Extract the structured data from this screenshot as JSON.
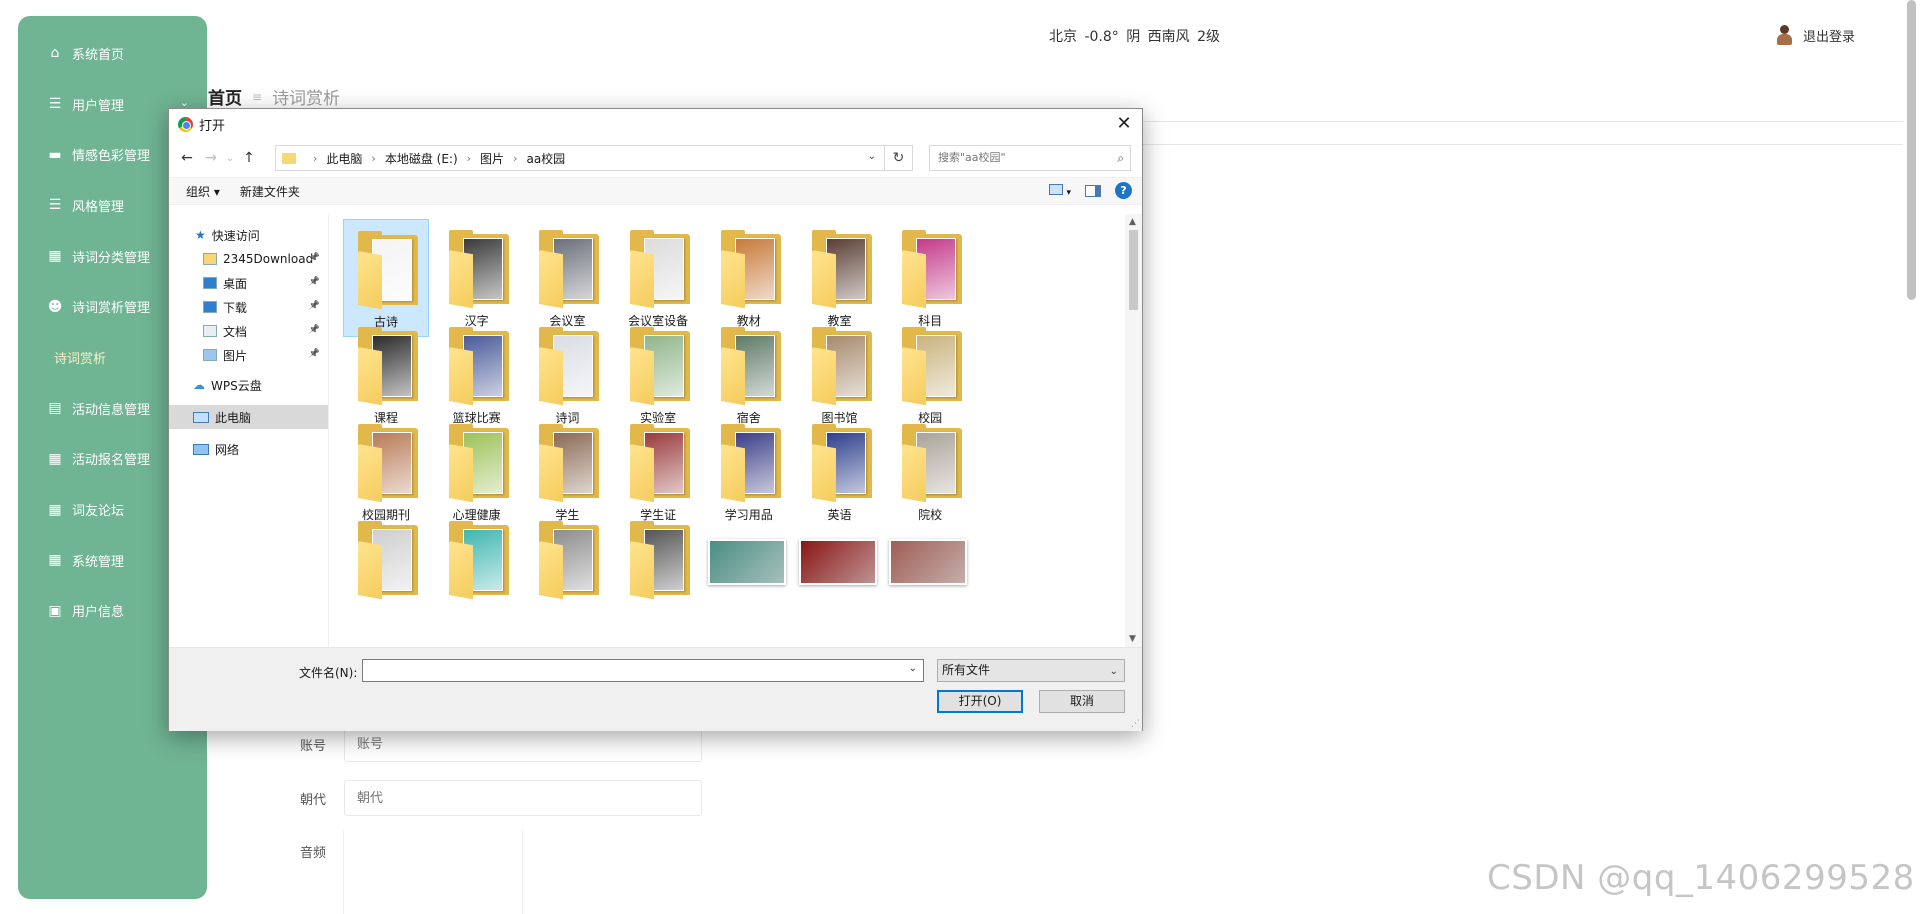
{
  "sidebar": {
    "items": [
      {
        "label": "系统首页",
        "icon": "home-icon",
        "glyph": "⌂"
      },
      {
        "label": "用户管理",
        "icon": "list-icon",
        "glyph": "☰",
        "chevron": "⌄"
      },
      {
        "label": "情感色彩管理",
        "icon": "monitor-icon",
        "glyph": "▬"
      },
      {
        "label": "风格管理",
        "icon": "list-icon",
        "glyph": "☰"
      },
      {
        "label": "诗词分类管理",
        "icon": "grid-icon",
        "glyph": "▦"
      },
      {
        "label": "诗词赏析管理",
        "icon": "user-icon",
        "glyph": "☻"
      },
      {
        "label": "诗词赏析",
        "icon": "",
        "glyph": "",
        "sub": true
      },
      {
        "label": "活动信息管理",
        "icon": "clipboard-icon",
        "glyph": "▤"
      },
      {
        "label": "活动报名管理",
        "icon": "grid-icon",
        "glyph": "▦"
      },
      {
        "label": "词友论坛",
        "icon": "grid-icon",
        "glyph": "▦"
      },
      {
        "label": "系统管理",
        "icon": "grid-icon",
        "glyph": "▦"
      },
      {
        "label": "用户信息",
        "icon": "card-icon",
        "glyph": "▣"
      }
    ]
  },
  "header": {
    "weather": "北京  -0.8°  阴  西南风  2级",
    "logout_label": "退出登录"
  },
  "breadcrumb": {
    "home": "首页",
    "separator": "≡",
    "current": "诗词赏析"
  },
  "form": {
    "account_label": "账号",
    "account_placeholder": "账号",
    "dynasty_label": "朝代",
    "dynasty_placeholder": "朝代",
    "audio_label": "音频"
  },
  "watermark": "CSDN @qq_1406299528",
  "dialog": {
    "title": "打开",
    "close": "✕",
    "nav": {
      "back": "←",
      "forward": "→",
      "recent": "⌄",
      "up": "↑",
      "refresh": "↻"
    },
    "address": [
      "此电脑",
      "本地磁盘 (E:)",
      "图片",
      "aa校园"
    ],
    "address_sep": "›",
    "search_placeholder": "搜索\"aa校园\"",
    "toolbar": {
      "organize": "组织 ▾",
      "new_folder": "新建文件夹",
      "help": "?"
    },
    "nav_pane": {
      "quick_access": "快速访问",
      "pinned": [
        {
          "label": "2345Download",
          "icon": "folder-icon"
        },
        {
          "label": "桌面",
          "icon": "desktop-icon"
        },
        {
          "label": "下载",
          "icon": "download-icon"
        },
        {
          "label": "文档",
          "icon": "document-icon"
        },
        {
          "label": "图片",
          "icon": "pictures-icon"
        }
      ],
      "wps": "WPS云盘",
      "this_pc": "此电脑",
      "network": "网络"
    },
    "items": [
      {
        "label": "古诗",
        "type": "folder",
        "selected": true,
        "thumb": "#f4f4f4"
      },
      {
        "label": "汉字",
        "type": "folder",
        "thumb": "#3a3a3a"
      },
      {
        "label": "会议室",
        "type": "folder",
        "thumb": "#6b6f79"
      },
      {
        "label": "会议室设备",
        "type": "folder",
        "thumb": "#dcdcdc"
      },
      {
        "label": "教材",
        "type": "folder",
        "thumb": "#c77a3b"
      },
      {
        "label": "教室",
        "type": "folder",
        "thumb": "#5a3e34"
      },
      {
        "label": "科目",
        "type": "folder",
        "thumb": "#c33a8a"
      },
      {
        "label": "课程",
        "type": "folder",
        "thumb": "#2b2b2b"
      },
      {
        "label": "篮球比赛",
        "type": "folder",
        "thumb": "#4a5a9a"
      },
      {
        "label": "诗词",
        "type": "folder",
        "thumb": "#d9dde3"
      },
      {
        "label": "实验室",
        "type": "folder",
        "thumb": "#8fb58a"
      },
      {
        "label": "宿舍",
        "type": "folder",
        "thumb": "#5f7a68"
      },
      {
        "label": "图书馆",
        "type": "folder",
        "thumb": "#a68a6d"
      },
      {
        "label": "校园",
        "type": "folder",
        "thumb": "#c9b37f"
      },
      {
        "label": "校园期刊",
        "type": "folder",
        "thumb": "#b97b58"
      },
      {
        "label": "心理健康",
        "type": "folder",
        "thumb": "#9cc15a"
      },
      {
        "label": "学生",
        "type": "folder",
        "thumb": "#8a6b55"
      },
      {
        "label": "学生证",
        "type": "folder",
        "thumb": "#9a3b3b"
      },
      {
        "label": "学习用品",
        "type": "folder",
        "thumb": "#3b3f88"
      },
      {
        "label": "英语",
        "type": "folder",
        "thumb": "#2c3f8c"
      },
      {
        "label": "院校",
        "type": "folder",
        "thumb": "#a9a39a"
      },
      {
        "label": "",
        "type": "folder",
        "thumb": "#cfcfcf"
      },
      {
        "label": "",
        "type": "folder",
        "thumb": "#3fb6b0"
      },
      {
        "label": "",
        "type": "folder",
        "thumb": "#8d8d8d"
      },
      {
        "label": "",
        "type": "folder",
        "thumb": "#555555"
      },
      {
        "label": "",
        "type": "image",
        "thumb": "#4a8e83"
      },
      {
        "label": "",
        "type": "image",
        "thumb": "#8b1616"
      },
      {
        "label": "",
        "type": "image",
        "thumb": "#9e5e55"
      }
    ],
    "filename_label": "文件名(N):",
    "filename_value": "",
    "filter": "所有文件",
    "open_button": "打开(O)",
    "cancel_button": "取消"
  }
}
